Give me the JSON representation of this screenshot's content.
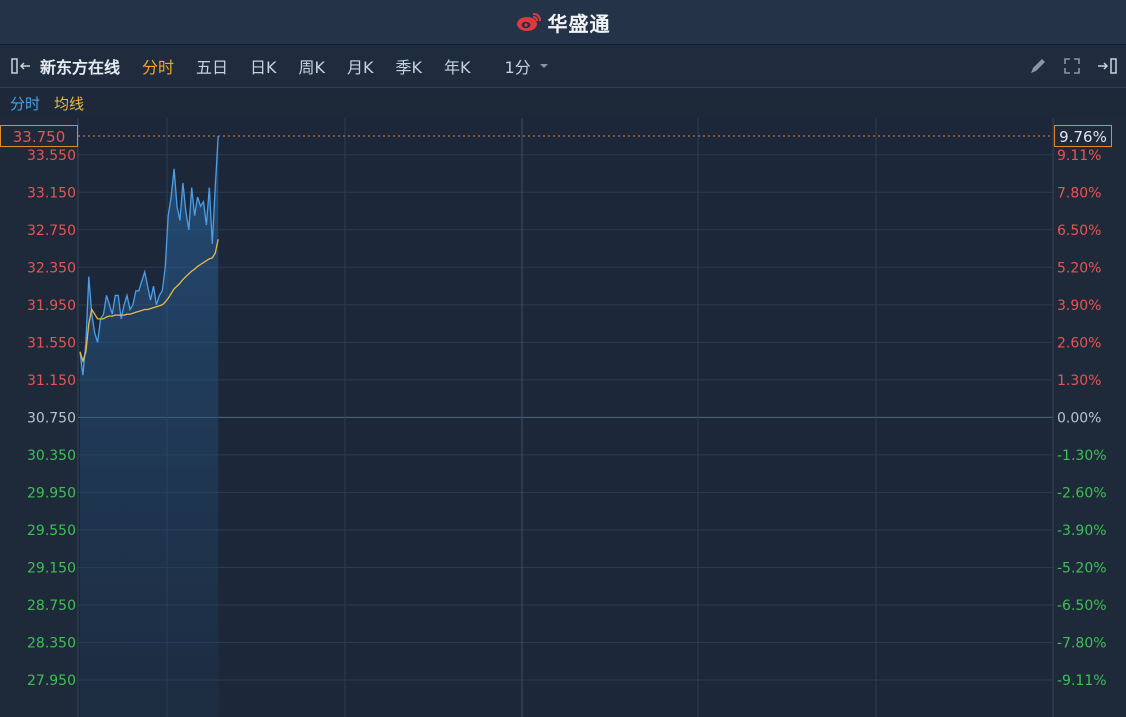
{
  "header": {
    "brand": "华盛通",
    "brand_color": "#e0383e"
  },
  "toolbar": {
    "stock_name": "新东方在线",
    "tabs": [
      "分时",
      "五日",
      "日K",
      "周K",
      "月K",
      "季K",
      "年K"
    ],
    "active_tab": "分时",
    "interval": "1分",
    "icons": [
      "collapse-left-icon",
      "pencil-icon",
      "fullscreen-icon",
      "collapse-right-icon"
    ]
  },
  "legend": {
    "line1": "分时",
    "line2": "均线",
    "line1_color": "#4a9fe8",
    "line2_color": "#e8b84a"
  },
  "current": {
    "price": "33.750",
    "change_pct": "9.76%"
  },
  "chart_data": {
    "type": "line",
    "prev_close": 30.75,
    "ylim": [
      27.95,
      33.75
    ],
    "grid": true,
    "y_ticks_left": [
      "33.550",
      "33.150",
      "32.750",
      "32.350",
      "31.950",
      "31.550",
      "31.150",
      "30.750",
      "30.350",
      "29.950",
      "29.550",
      "29.150",
      "28.750",
      "28.350",
      "27.950"
    ],
    "y_ticks_right": [
      "9.11%",
      "7.80%",
      "6.50%",
      "5.20%",
      "3.90%",
      "2.60%",
      "1.30%",
      "0.00%",
      "-1.30%",
      "-2.60%",
      "-3.90%",
      "-5.20%",
      "-6.50%",
      "-7.80%",
      "-9.11%"
    ],
    "up_color": "#e85454",
    "down_color": "#3fbf55",
    "neutral_color": "#b9c2ce",
    "series": [
      {
        "name": "分时",
        "color": "#4a9fe8",
        "values": [
          31.45,
          31.2,
          31.55,
          32.25,
          31.85,
          31.65,
          31.55,
          31.8,
          31.85,
          32.05,
          31.95,
          31.85,
          32.05,
          32.05,
          31.8,
          31.95,
          32.05,
          31.9,
          31.95,
          32.1,
          32.1,
          32.2,
          32.3,
          32.15,
          32.0,
          32.15,
          31.95,
          32.05,
          32.1,
          32.35,
          32.9,
          33.1,
          33.4,
          33.0,
          32.85,
          33.25,
          32.95,
          32.75,
          33.2,
          32.9,
          33.1,
          33.0,
          33.05,
          32.8,
          33.2,
          32.6,
          33.2,
          33.75
        ]
      },
      {
        "name": "均线",
        "color": "#e8b84a",
        "values": [
          31.45,
          31.35,
          31.45,
          31.75,
          31.9,
          31.85,
          31.8,
          31.8,
          31.8,
          31.82,
          31.83,
          31.83,
          31.84,
          31.84,
          31.84,
          31.84,
          31.85,
          31.85,
          31.86,
          31.87,
          31.88,
          31.89,
          31.9,
          31.9,
          31.91,
          31.92,
          31.93,
          31.94,
          31.95,
          31.98,
          32.02,
          32.07,
          32.12,
          32.15,
          32.18,
          32.22,
          32.25,
          32.28,
          32.31,
          32.33,
          32.36,
          32.38,
          32.4,
          32.42,
          32.44,
          32.45,
          32.5,
          32.65
        ]
      }
    ]
  }
}
